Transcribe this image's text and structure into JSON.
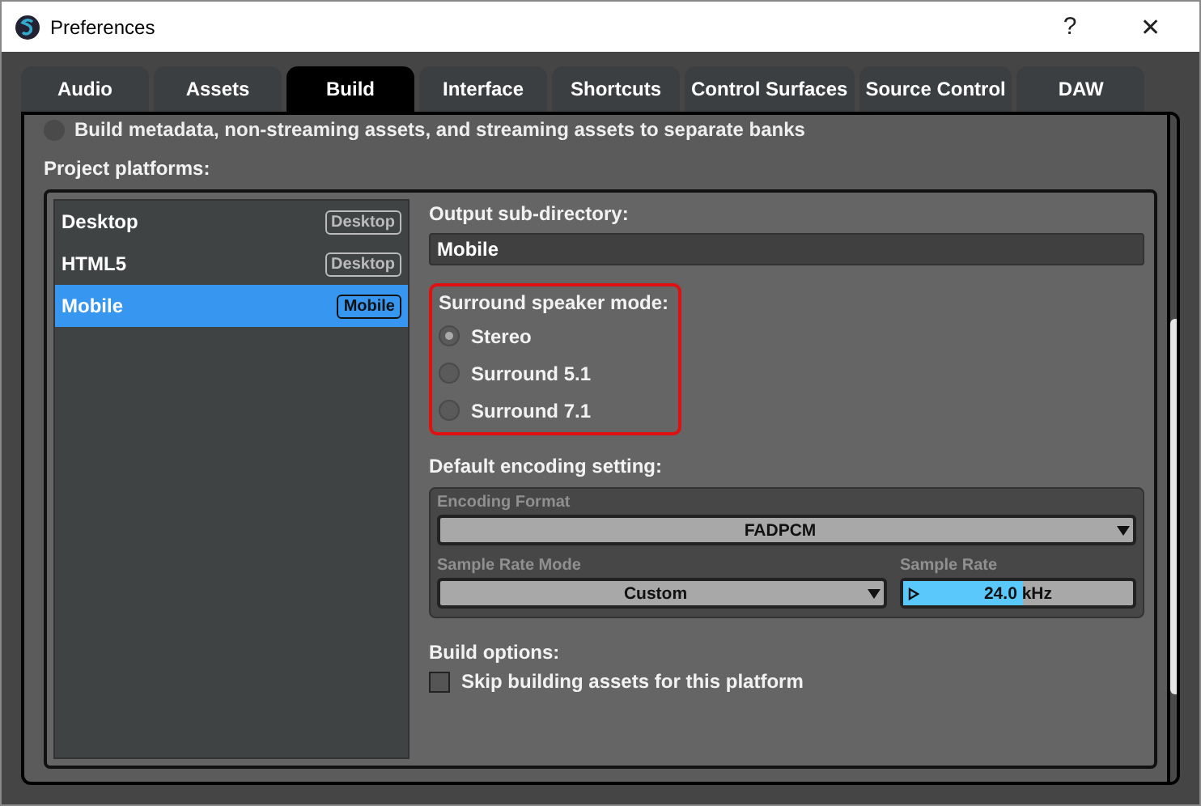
{
  "window": {
    "title": "Preferences",
    "help": "?",
    "close": "✕"
  },
  "tabs": [
    {
      "label": "Audio",
      "selected": false
    },
    {
      "label": "Assets",
      "selected": false
    },
    {
      "label": "Build",
      "selected": true
    },
    {
      "label": "Interface",
      "selected": false
    },
    {
      "label": "Shortcuts",
      "selected": false
    },
    {
      "label": "Control Surfaces",
      "selected": false
    },
    {
      "label": "Source Control",
      "selected": false
    },
    {
      "label": "DAW",
      "selected": false
    }
  ],
  "cut_option": {
    "label": "Build metadata, non-streaming assets, and streaming assets to separate banks",
    "selected": false
  },
  "platforms_label": "Project platforms:",
  "platforms": [
    {
      "name": "Desktop",
      "badge": "Desktop",
      "selected": false
    },
    {
      "name": "HTML5",
      "badge": "Desktop",
      "selected": false
    },
    {
      "name": "Mobile",
      "badge": "Mobile",
      "selected": true
    }
  ],
  "output": {
    "label": "Output sub-directory:",
    "value": "Mobile"
  },
  "surround": {
    "label": "Surround speaker mode:",
    "options": [
      {
        "label": "Stereo",
        "selected": true
      },
      {
        "label": "Surround 5.1",
        "selected": false
      },
      {
        "label": "Surround 7.1",
        "selected": false
      }
    ]
  },
  "encoding": {
    "label": "Default encoding setting:",
    "format_label": "Encoding Format",
    "format": "FADPCM",
    "mode_label": "Sample Rate Mode",
    "mode": "Custom",
    "rate_label": "Sample Rate",
    "rate_value": "24.0",
    "rate_unit": "kHz",
    "level": 0.52
  },
  "build_options": {
    "label": "Build options:",
    "checks": [
      {
        "label": "Skip building assets for this platform",
        "checked": false
      }
    ]
  }
}
